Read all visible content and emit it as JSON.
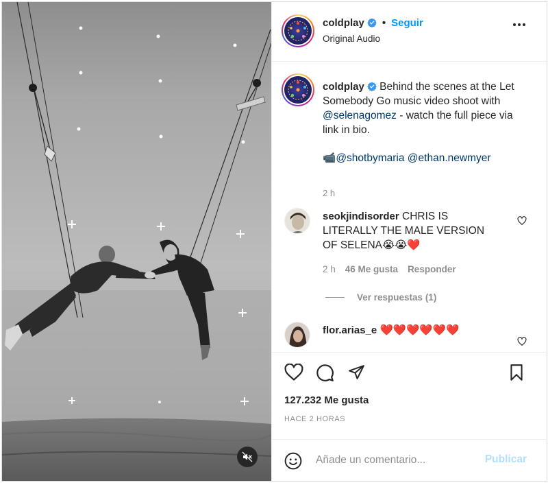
{
  "post": {
    "username": "coldplay",
    "follow_label": "Seguir",
    "separator": "•",
    "audio": "Original Audio"
  },
  "caption": {
    "username": "coldplay",
    "text_1": "Behind the scenes at the Let Somebody Go music video shoot with ",
    "mention_1": "@selenagomez",
    "text_2": " - watch the full piece via link in bio.",
    "credit_emoji": "📹",
    "mention_2": "@shotbymaria",
    "mention_3": "@ethan.newmyer",
    "time": "2 h"
  },
  "comments": [
    {
      "username": "seokjindisorder",
      "text": "CHRIS IS LITERALLY THE MALE VERSION OF SELENA😭😭❤️",
      "time": "2 h",
      "likes": "46 Me gusta",
      "reply_label": "Responder",
      "view_replies": "Ver respuestas (1)"
    },
    {
      "username": "flor.arias_e",
      "text": "❤️❤️❤️❤️❤️❤️"
    }
  ],
  "stats": {
    "likes": "127.232 Me gusta",
    "posted": "HACE 2 HORAS"
  },
  "add_comment": {
    "placeholder": "Añade un comentario...",
    "publish_label": "Publicar"
  },
  "icons": {
    "verified": "verified-badge-icon",
    "more": "more-options-icon",
    "like": "heart-icon",
    "comment": "comment-icon",
    "share": "paper-plane-icon",
    "save": "bookmark-icon",
    "emoji": "emoji-icon",
    "mute": "muted-speaker-icon"
  },
  "colors": {
    "accent": "#0095f6",
    "link": "#00376b",
    "verified": "#3897f0",
    "publish_disabled": "#b2dffc",
    "muted_text": "#8e8e8e"
  }
}
